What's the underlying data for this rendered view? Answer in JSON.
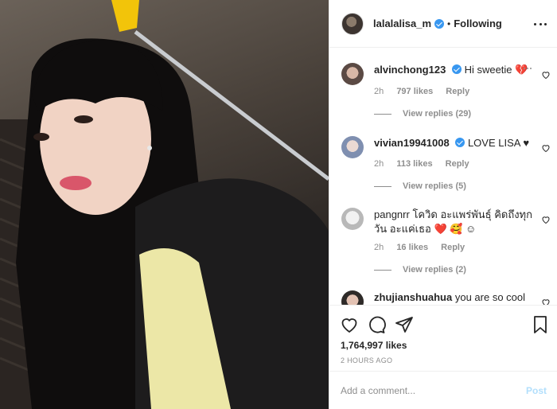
{
  "post": {
    "image_alt": "selfie photo",
    "author": "lalalalisa_m",
    "separator": "•",
    "follow_status": "Following",
    "likes": "1,764,997 likes",
    "time_ago": "2 HOURS AGO"
  },
  "comments": [
    {
      "user": "alvinchong123",
      "verified": true,
      "text": "Hi sweetie 💔",
      "time": "2h",
      "likes": "797 likes",
      "reply": "Reply",
      "view_replies": "View replies (29)"
    },
    {
      "user": "vivian19941008",
      "verified": true,
      "text": "LOVE LISA ♥",
      "time": "2h",
      "likes": "113 likes",
      "reply": "Reply",
      "view_replies": "View replies (5)"
    },
    {
      "user": "pangnrr",
      "verified": false,
      "text": "โควิด อะแพร่พันธุ์ คิดถึงทุกวัน อะแค่เธอ ❤️ 🥰 ☺",
      "time": "2h",
      "likes": "16 likes",
      "reply": "Reply",
      "view_replies": "View replies (2)"
    },
    {
      "user": "zhujianshuahua",
      "verified": false,
      "text": "you are so cool",
      "time": "",
      "likes": "",
      "reply": "",
      "view_replies": ""
    }
  ],
  "composer": {
    "placeholder": "Add a comment...",
    "post_label": "Post"
  },
  "colors": {
    "accent": "#3897f0",
    "post_disabled": "#b2dffc",
    "muted": "#8e8e8e",
    "text": "#262626"
  },
  "icons": [
    "more-icon",
    "heart-icon",
    "comment-icon",
    "share-icon",
    "bookmark-icon",
    "verified-icon"
  ]
}
